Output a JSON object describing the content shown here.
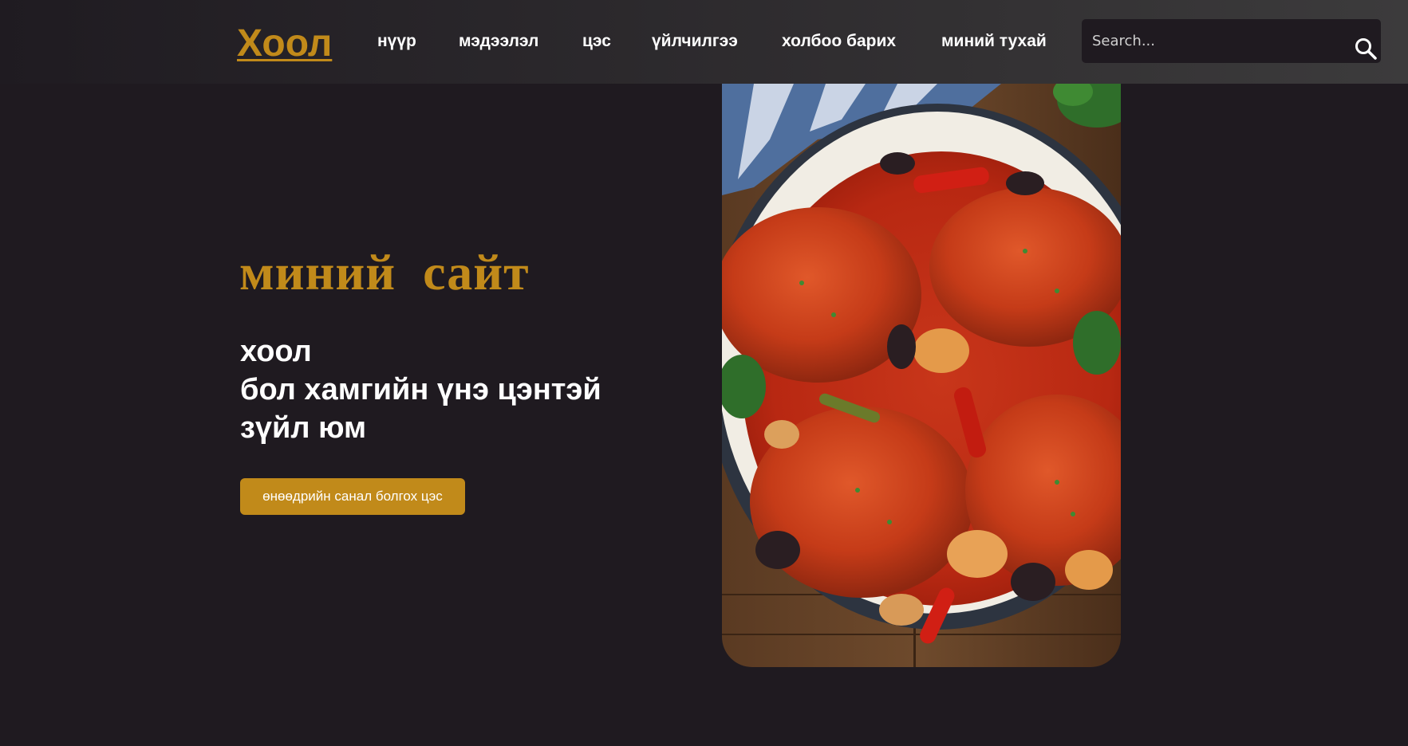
{
  "header": {
    "logo": "Хоол",
    "nav": [
      {
        "label": "нүүр"
      },
      {
        "label": "мэдээлэл"
      },
      {
        "label": "цэс"
      },
      {
        "label": "үйлчилгээ"
      },
      {
        "label": "холбоо барих"
      },
      {
        "label": "миний тухай"
      }
    ],
    "search": {
      "placeholder": "Search...",
      "value": ""
    }
  },
  "hero": {
    "title": "миний  сайт",
    "lines": [
      "хоол",
      "бол хамгийн үнэ цэнтэй",
      "зүйл юм"
    ],
    "button_label": "өнөөдрийн санал болгох цэс"
  },
  "image": {
    "subject": "chicken cacciatore in skillet"
  },
  "colors": {
    "background": "#1f1a20",
    "accent": "#c18a1a",
    "text": "#ffffff"
  },
  "icons": {
    "search": "search-icon"
  }
}
